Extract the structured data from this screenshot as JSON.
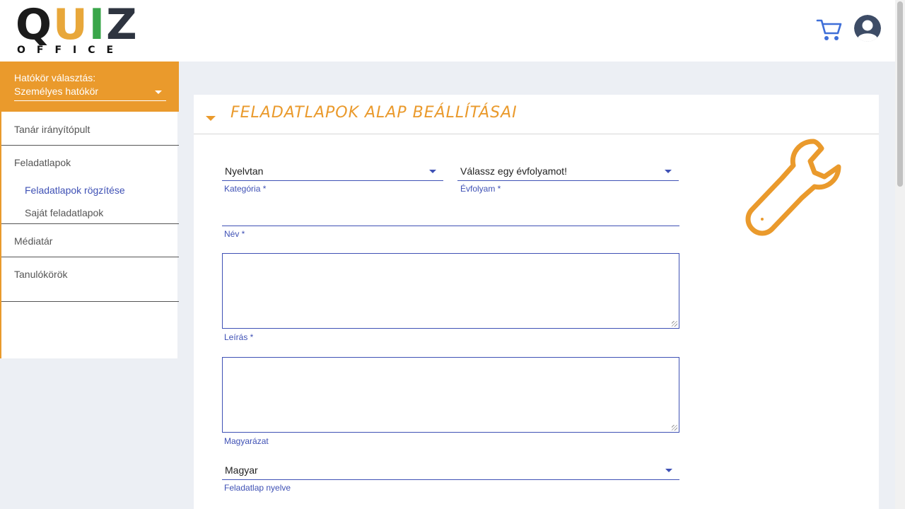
{
  "brand": {
    "logo_word": "QUIZ",
    "logo_sub": "OFFICE"
  },
  "header": {
    "cart_icon": "cart-icon",
    "avatar_icon": "user-avatar-icon"
  },
  "sidebar": {
    "scope_label": "Hatókör választás:",
    "scope_value": "Személyes hatókör",
    "items": [
      {
        "label": "Tanár irányítópult"
      },
      {
        "label": "Feladatlapok"
      },
      {
        "label": "Médiatár"
      },
      {
        "label": "Tanulókörök"
      }
    ],
    "sub_items": [
      {
        "label": "Feladatlapok rögzítése",
        "active": true
      },
      {
        "label": "Saját feladatlapok",
        "active": false
      }
    ]
  },
  "card": {
    "title": "FELADATLAPOK ALAP BEÁLLÍTÁSAI",
    "fields": {
      "category": {
        "value": "Nyelvtan",
        "label": "Kategória *"
      },
      "grade": {
        "value": "Válassz egy évfolyamot!",
        "label": "Évfolyam *"
      },
      "name": {
        "value": "",
        "label": "Név *"
      },
      "description": {
        "value": "",
        "label": "Leírás *"
      },
      "explanation": {
        "value": "",
        "label": "Magyarázat"
      },
      "language": {
        "value": "Magyar",
        "label": "Feladatlap nyelve"
      }
    }
  },
  "colors": {
    "accent": "#ea9a2c",
    "primary": "#3f51b5",
    "active_link": "#3f51b5"
  }
}
